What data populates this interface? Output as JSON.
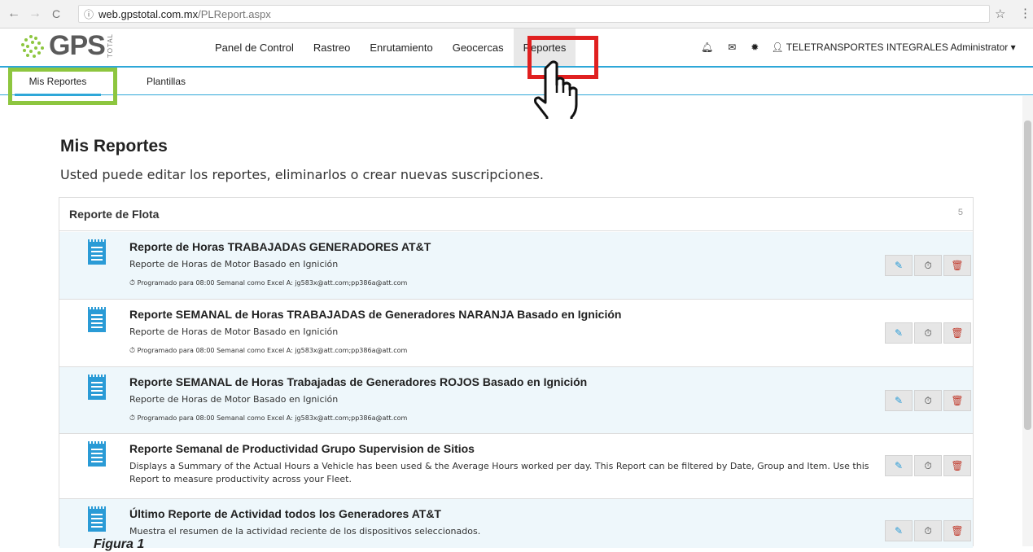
{
  "browser": {
    "back": "←",
    "forward": "→",
    "reload": "C",
    "url_host": "web.gpstotal.com.mx",
    "url_path": "/PLReport.aspx",
    "star": "☆",
    "menu": "⋮"
  },
  "logo": {
    "text": "GPS",
    "sub": "TOTAL"
  },
  "menu": [
    {
      "label": "Panel de Control"
    },
    {
      "label": "Rastreo"
    },
    {
      "label": "Enrutamiento"
    },
    {
      "label": "Geocercas"
    },
    {
      "label": "Reportes",
      "active": true
    }
  ],
  "user": {
    "name": "TELETRANSPORTES INTEGRALES Administrator ▾"
  },
  "subnav": {
    "tab1": "Mis Reportes",
    "tab2": "Plantillas"
  },
  "page": {
    "title": "Mis Reportes",
    "subtitle": "Usted puede editar los reportes, eliminarlos o crear nuevas suscripciones."
  },
  "panel": {
    "heading": "Reporte de Flota",
    "count": "5",
    "reports": [
      {
        "title": "Reporte de Horas TRABAJADAS GENERADORES AT&T",
        "desc": "Reporte de Horas de Motor Basado en Ignición",
        "schedule": "Programado para 08:00 Semanal como Excel",
        "recipients": "A: jg583x@att.com;pp386a@att.com"
      },
      {
        "title": "Reporte SEMANAL de Horas TRABAJADAS de Generadores NARANJA Basado en Ignición",
        "desc": "Reporte de Horas de Motor Basado en Ignición",
        "schedule": "Programado para 08:00 Semanal como Excel",
        "recipients": "A: jg583x@att.com;pp386a@att.com"
      },
      {
        "title": "Reporte SEMANAL de Horas Trabajadas de Generadores ROJOS Basado en Ignición",
        "desc": "Reporte de Horas de Motor Basado en Ignición",
        "schedule": "Programado para 08:00 Semanal como Excel",
        "recipients": "A: jg583x@att.com;pp386a@att.com"
      },
      {
        "title": "Reporte Semanal de Productividad Grupo Supervision de Sitios",
        "desc": "Displays a Summary of the Actual Hours a Vehicle has been used & the Average Hours worked per day. This Report can be filtered by Date, Group and Item. Use this Report to measure productivity across your Fleet."
      },
      {
        "title": "Último Reporte de Actividad todos los Generadores AT&T",
        "desc": "Muestra el resumen de la actividad reciente de los dispositivos seleccionados."
      }
    ]
  },
  "figure_caption": "Figura 1"
}
